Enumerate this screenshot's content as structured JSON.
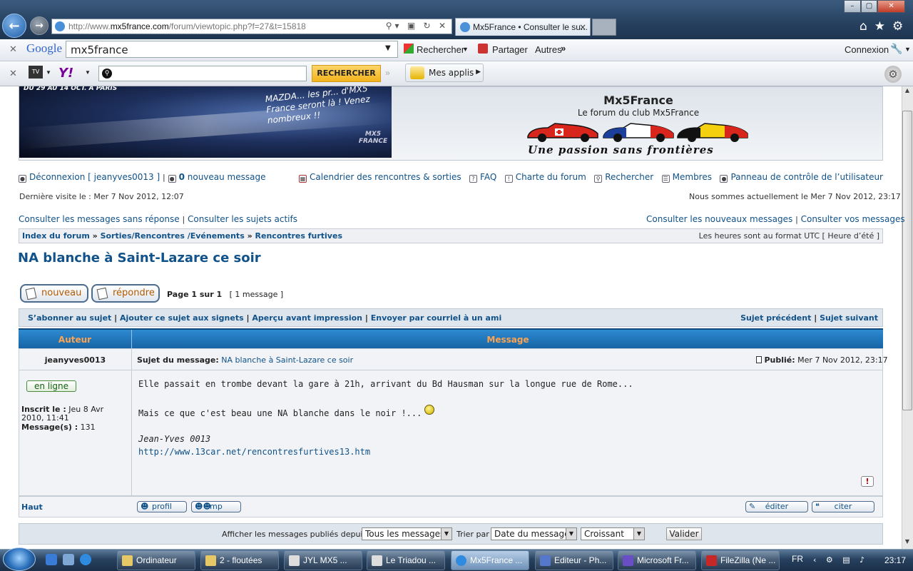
{
  "browser": {
    "url_prefix": "http://www.",
    "url_host": "mx5france.com",
    "url_path": "/forum/viewtopic.php?f=27&t=15818",
    "tab_title": "Mx5France • Consulter le su...",
    "tab_close": "×"
  },
  "toolbar_google": {
    "logo": "Google",
    "search_value": "mx5france",
    "search_label": "Rechercher",
    "share_label": "Partager",
    "more_label": "Autres",
    "login_label": "Connexion"
  },
  "toolbar_yahoo": {
    "logo": "Y!",
    "button_label": "RECHERCHER",
    "apps_label": "Mes applis"
  },
  "header": {
    "banner_dates": "DU 29 AU 14 OCT. A PARIS",
    "banner_text": "MAZDA... les pr... d'MX5 France seront là ! Venez nombreux !!",
    "banner_logo": "MX5 FRANCE",
    "site_title": "Mx5France",
    "site_subtitle": "Le forum du club Mx5France",
    "slogan": "Une passion sans frontières"
  },
  "nav": {
    "logout": "Déconnexion [ jeanyves0013 ]",
    "new_count": "0",
    "new_messages": "nouveau message",
    "calendar": "Calendrier des rencontres & sorties",
    "faq": "FAQ",
    "charter": "Charte du forum",
    "search": "Rechercher",
    "members": "Membres",
    "ucp": "Panneau de contrôle de l’utilisateur",
    "last_visit": "Dernière visite le : Mer 7 Nov 2012, 12:07",
    "current_time": "Nous sommes actuellement le Mer 7 Nov 2012, 23:17",
    "unanswered": "Consulter les messages sans réponse",
    "active": "Consulter les sujets actifs",
    "new_posts": "Consulter les nouveaux messages",
    "your_posts": "Consulter vos messages",
    "sep": "|"
  },
  "breadcrumb": {
    "items": [
      "Index du forum",
      "Sorties/Rencontres /Evénements",
      "Rencontres furtives"
    ],
    "sep": "»",
    "timezone": "Les heures sont au format UTC [ Heure d’été ]"
  },
  "topic": {
    "title": "NA blanche à Saint-Lazare ce soir",
    "btn_new": "nouveau",
    "btn_reply": "répondre",
    "page_info": "Page 1 sur 1",
    "msg_count": "[ 1 message ]",
    "actions": [
      "S’abonner au sujet",
      "Ajouter ce sujet aux signets",
      "Aperçu avant impression",
      "Envoyer par courriel à un ami"
    ],
    "prev": "Sujet précédent",
    "next": "Sujet suivant",
    "col_author": "Auteur",
    "col_message": "Message"
  },
  "post": {
    "author": "jeanyves0013",
    "subject_label": "Sujet du message:",
    "subject": "NA blanche à Saint-Lazare ce soir",
    "published_label": "Publié:",
    "published": "Mer 7 Nov 2012, 23:17",
    "online": "en ligne",
    "registered_label": "Inscrit le :",
    "registered": "Jeu 8 Avr 2010, 11:41",
    "messages_label": "Message(s) :",
    "messages": "131",
    "line1": "Elle passait en trombe devant la gare à 21h, arrivant du Bd Hausman sur la longue rue de Rome...",
    "line2": "Mais ce que c'est beau une NA blanche dans le noir !...",
    "signature": "Jean-Yves 0013",
    "sig_link": "http://www.13car.net/rencontresfurtives13.htm",
    "report": "!",
    "top": "Haut",
    "profile": "profil",
    "pm": "mp",
    "edit": "éditer",
    "quote": "citer"
  },
  "filter": {
    "show_label": "Afficher les messages publiés depuis :",
    "show_value": "Tous les messages",
    "sort_label": "Trier par",
    "sort_value": "Date du message",
    "order_value": "Croissant",
    "submit": "Valider"
  },
  "taskbar": {
    "items": [
      "Ordinateur",
      "2 - floutées",
      "JYL   MX5 ...",
      "Le Triadou ...",
      "Mx5France ...",
      "Editeur - Ph...",
      "Microsoft Fr...",
      "FileZilla (Ne ..."
    ],
    "lang": "FR",
    "clock": "23:17"
  }
}
